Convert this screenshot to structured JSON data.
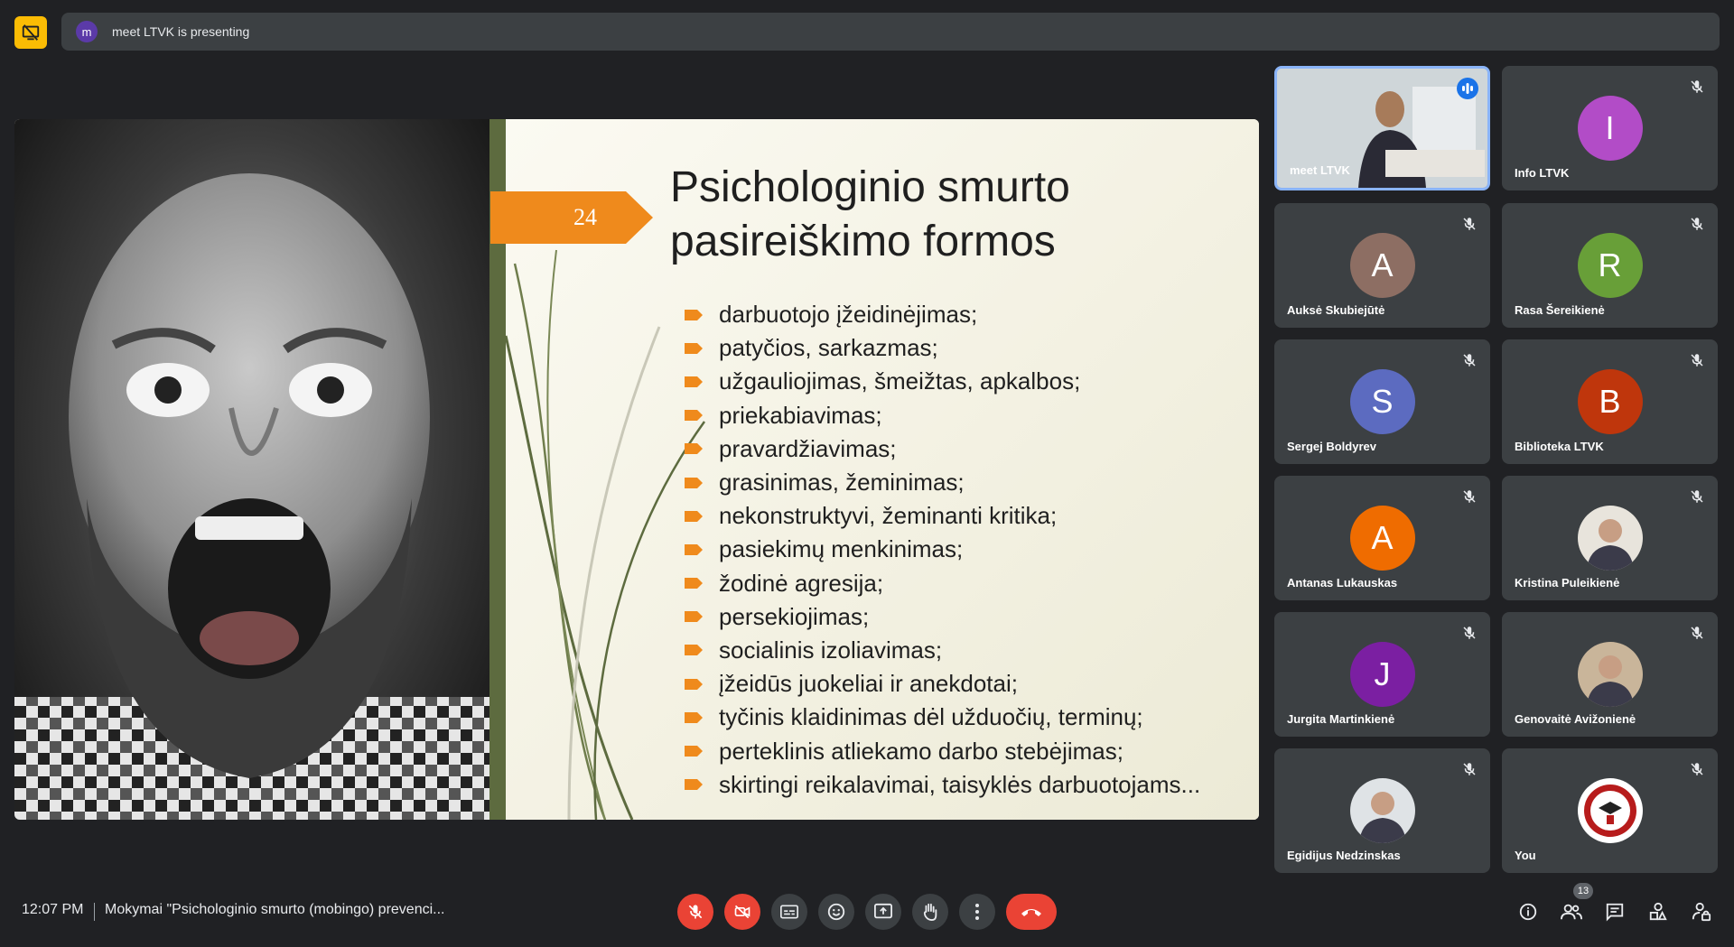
{
  "presenting_bar": {
    "avatar_letter": "m",
    "text": "meet LTVK is presenting"
  },
  "slide": {
    "number": "24",
    "title_line1": "Psichologinio smurto",
    "title_line2": "pasireiškimo formos",
    "bullets": [
      "darbuotojo įžeidinėjimas;",
      "patyčios, sarkazmas;",
      "užgauliojimas, šmeižtas, apkalbos;",
      "priekabiavimas;",
      "pravardžiavimas;",
      "grasinimas, žeminimas;",
      "nekonstruktyvi, žeminanti kritika;",
      "pasiekimų menkinimas;",
      "žodinė agresija;",
      "persekiojimas;",
      "socialinis izoliavimas;",
      "įžeidūs juokeliai ir anekdotai;",
      "tyčinis klaidinimas dėl užduočių, terminų;",
      "perteklinis atliekamo darbo stebėjimas;",
      "skirtingi reikalavimai, taisyklės darbuotojams..."
    ]
  },
  "participants": [
    {
      "name": "meet LTVK",
      "initial": "",
      "color": "",
      "type": "video"
    },
    {
      "name": "Info LTVK",
      "initial": "I",
      "color": "#b24cc7",
      "type": "letter"
    },
    {
      "name": "Auksė Skubiejūtė",
      "initial": "A",
      "color": "#8d6e63",
      "type": "letter"
    },
    {
      "name": "Rasa Šereikienė",
      "initial": "R",
      "color": "#689f38",
      "type": "letter"
    },
    {
      "name": "Sergej Boldyrev",
      "initial": "S",
      "color": "#5c6bc0",
      "type": "letter"
    },
    {
      "name": "Biblioteka LTVK",
      "initial": "B",
      "color": "#bf360c",
      "type": "letter"
    },
    {
      "name": "Antanas Lukauskas",
      "initial": "A",
      "color": "#ef6c00",
      "type": "letter"
    },
    {
      "name": "Kristina Puleikienė",
      "initial": "",
      "color": "#e8e4dc",
      "type": "photo"
    },
    {
      "name": "Jurgita Martinkienė",
      "initial": "J",
      "color": "#7b1fa2",
      "type": "letter"
    },
    {
      "name": "Genovaitė Avižonienė",
      "initial": "",
      "color": "#c9b59a",
      "type": "photo"
    },
    {
      "name": "Egidijus Nedzinskas",
      "initial": "",
      "color": "#dfe3e6",
      "type": "photo"
    },
    {
      "name": "You",
      "initial": "",
      "color": "#ffffff",
      "type": "logo"
    }
  ],
  "bottom_bar": {
    "time": "12:07 PM",
    "meeting_title": "Mokymai \"Psichologinio smurto (mobingo) prevenci...",
    "participant_count": "13"
  }
}
